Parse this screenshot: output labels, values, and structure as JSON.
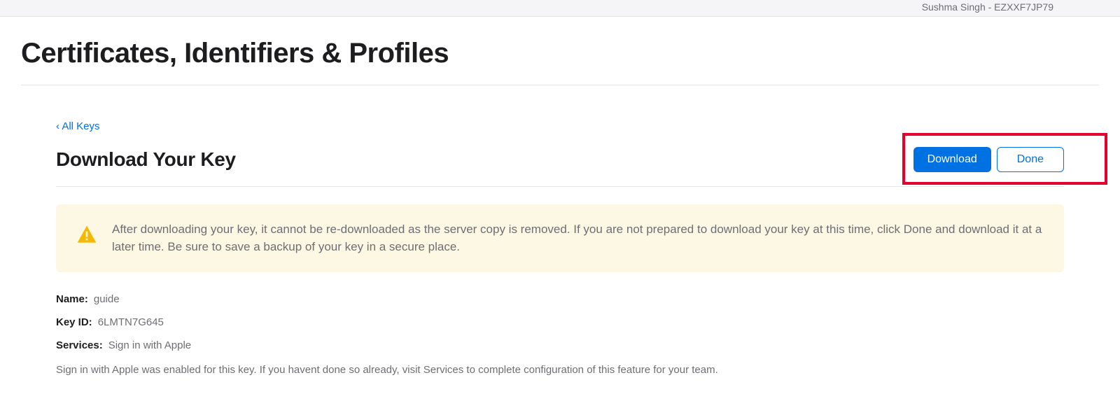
{
  "header": {
    "user_label": "Sushma Singh - EZXXF7JP79"
  },
  "page": {
    "title": "Certificates, Identifiers & Profiles"
  },
  "breadcrumb": {
    "back_label": "‹ All Keys"
  },
  "section": {
    "title": "Download Your Key",
    "download_button": "Download",
    "done_button": "Done"
  },
  "warning": {
    "message": "After downloading your key, it cannot be re-downloaded as the server copy is removed. If you are not prepared to download your key at this time, click Done and download it at a later time. Be sure to save a backup of your key in a secure place."
  },
  "details": {
    "name_label": "Name:",
    "name_value": "guide",
    "keyid_label": "Key ID:",
    "keyid_value": "6LMTN7G645",
    "services_label": "Services:",
    "services_value": "Sign in with Apple",
    "info_text": "Sign in with Apple was enabled for this key. If you havent done so already, visit Services to complete configuration of this feature for your team."
  }
}
